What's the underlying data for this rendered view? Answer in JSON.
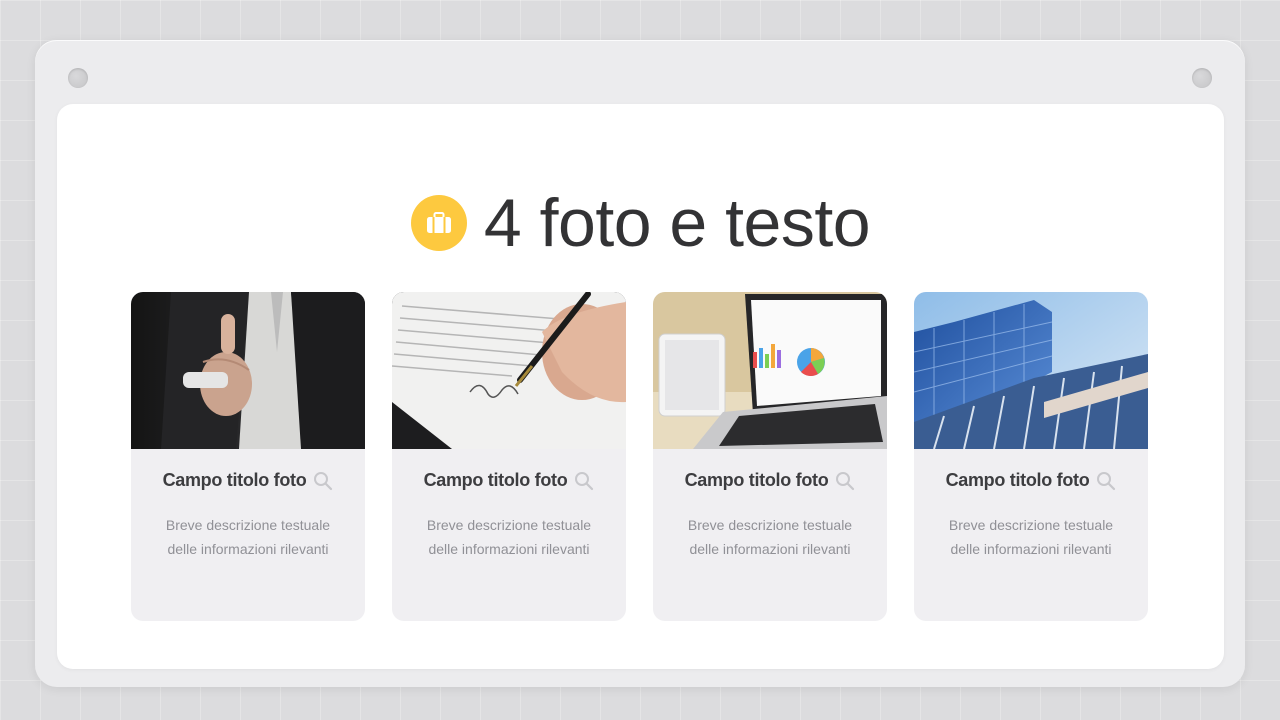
{
  "slide": {
    "title": "4 foto e testo",
    "title_icon": "briefcase-icon",
    "accent_color": "#fdc93f"
  },
  "cards": [
    {
      "photo": "thumbs-up-businessman-photo",
      "title": "Campo titolo foto",
      "action_icon": "search-icon",
      "description_line1": "Breve descrizione testuale",
      "description_line2": "delle informazioni rilevanti"
    },
    {
      "photo": "signing-document-photo",
      "title": "Campo titolo foto",
      "action_icon": "search-icon",
      "description_line1": "Breve descrizione testuale",
      "description_line2": "delle informazioni rilevanti"
    },
    {
      "photo": "laptop-charts-photo",
      "title": "Campo titolo foto",
      "action_icon": "search-icon",
      "description_line1": "Breve descrizione testuale",
      "description_line2": "delle informazioni rilevanti"
    },
    {
      "photo": "office-building-photo",
      "title": "Campo titolo foto",
      "action_icon": "search-icon",
      "description_line1": "Breve descrizione testuale",
      "description_line2": "delle informazioni rilevanti"
    }
  ]
}
